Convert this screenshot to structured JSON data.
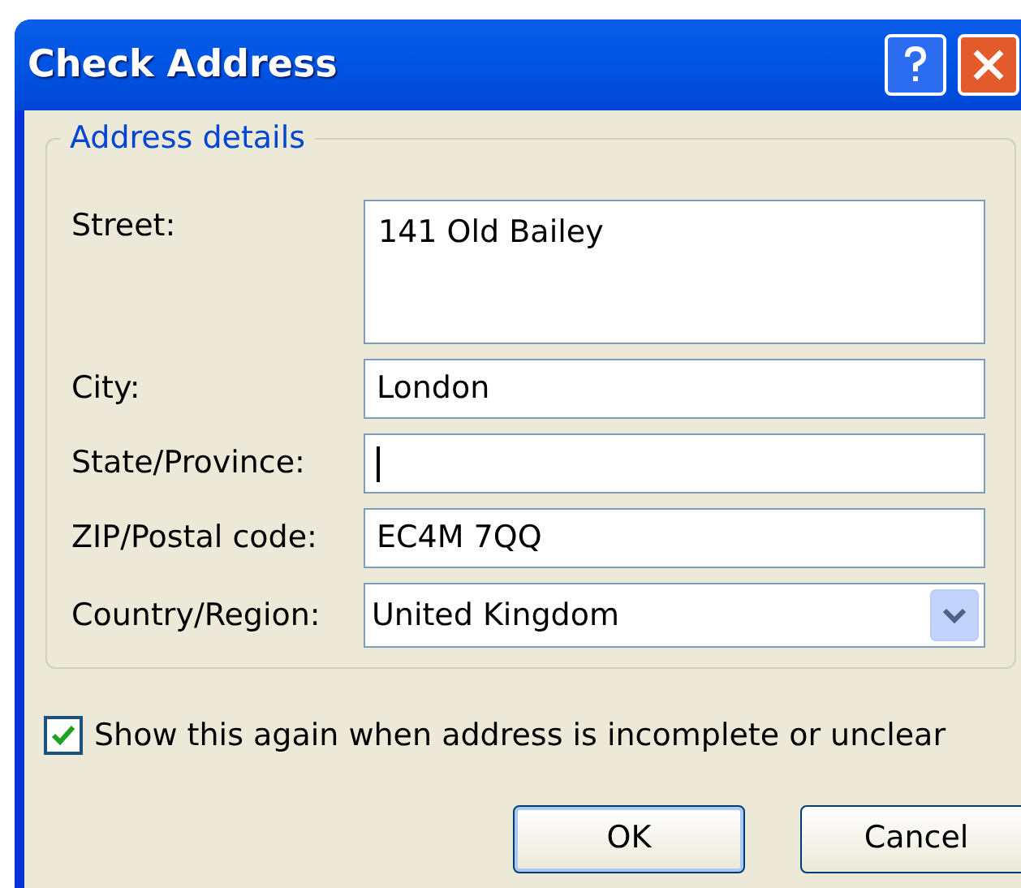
{
  "window": {
    "title": "Check Address"
  },
  "group": {
    "title": "Address details"
  },
  "fields": [
    {
      "kind": "multiline",
      "label": "Street:",
      "value": "141 Old Bailey",
      "focused": false
    },
    {
      "kind": "text",
      "label": "City:",
      "value": "London",
      "focused": false
    },
    {
      "kind": "text",
      "label": "State/Province:",
      "focused": true
    },
    {
      "kind": "text",
      "label": "ZIP/Postal code:",
      "value": "EC4M 7QQ",
      "focused": false
    },
    {
      "kind": "dropdown",
      "label": "Country/Region:",
      "value": "United Kingdom",
      "focused": false
    }
  ],
  "checkbox": {
    "label": "Show this again when address is incomplete or unclear",
    "checked": true
  },
  "buttons": [
    {
      "label": "OK",
      "default": true
    },
    {
      "label": "Cancel",
      "default": false
    }
  ]
}
